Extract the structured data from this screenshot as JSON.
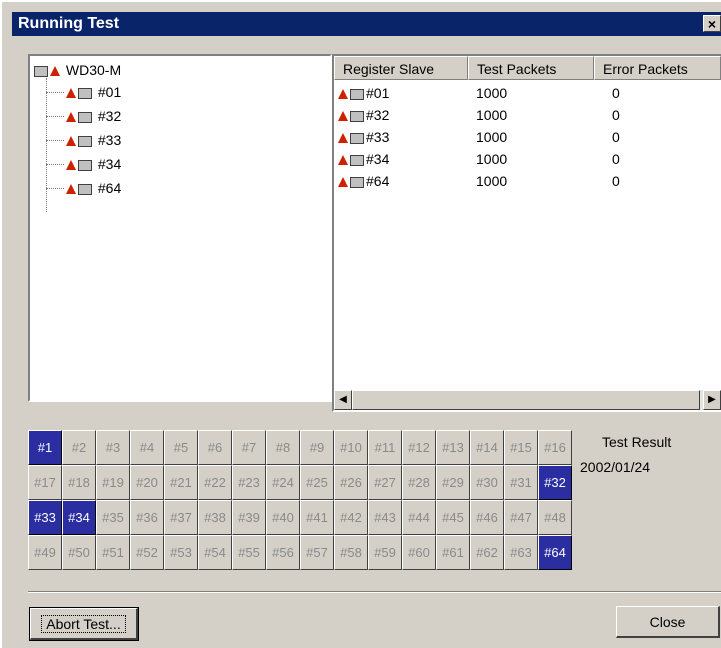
{
  "window": {
    "title": "Running Test",
    "close_glyph": "×"
  },
  "tree": {
    "root": "WD30-M",
    "items": [
      "#01",
      "#32",
      "#33",
      "#34",
      "#64"
    ]
  },
  "list": {
    "columns": [
      "Register Slave",
      "Test Packets",
      "Error Packets"
    ],
    "rows": [
      {
        "slave": "#01",
        "packets": "1000",
        "errors": "0"
      },
      {
        "slave": "#32",
        "packets": "1000",
        "errors": "0"
      },
      {
        "slave": "#33",
        "packets": "1000",
        "errors": "0"
      },
      {
        "slave": "#34",
        "packets": "1000",
        "errors": "0"
      },
      {
        "slave": "#64",
        "packets": "1000",
        "errors": "0"
      }
    ]
  },
  "slots": {
    "labels": [
      "#1",
      "#2",
      "#3",
      "#4",
      "#5",
      "#6",
      "#7",
      "#8",
      "#9",
      "#10",
      "#11",
      "#12",
      "#13",
      "#14",
      "#15",
      "#16",
      "#17",
      "#18",
      "#19",
      "#20",
      "#21",
      "#22",
      "#23",
      "#24",
      "#25",
      "#26",
      "#27",
      "#28",
      "#29",
      "#30",
      "#31",
      "#32",
      "#33",
      "#34",
      "#35",
      "#36",
      "#37",
      "#38",
      "#39",
      "#40",
      "#41",
      "#42",
      "#43",
      "#44",
      "#45",
      "#46",
      "#47",
      "#48",
      "#49",
      "#50",
      "#51",
      "#52",
      "#53",
      "#54",
      "#55",
      "#56",
      "#57",
      "#58",
      "#59",
      "#60",
      "#61",
      "#62",
      "#63",
      "#64"
    ],
    "active": [
      "#1",
      "#32",
      "#33",
      "#34",
      "#64"
    ]
  },
  "result": {
    "label": "Test Result",
    "date": "2002/01/24"
  },
  "buttons": {
    "abort": "Abort Test...",
    "close": "Close"
  },
  "colors": {
    "title_bar": "#0a246a",
    "active_slot": "#2a2ea0",
    "face": "#d4d0c8"
  }
}
